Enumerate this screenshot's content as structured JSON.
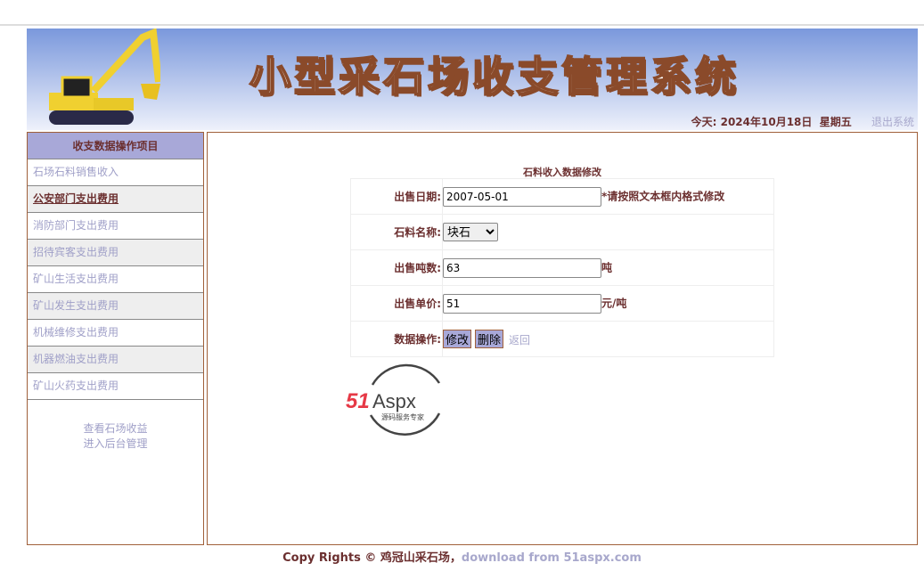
{
  "header": {
    "title": "小型采石场收支管理系统",
    "today_label": "今天:",
    "date": "2024年10月18日",
    "weekday": "星期五",
    "logout": "退出系统"
  },
  "sidebar": {
    "heading": "收支数据操作项目",
    "items": [
      {
        "label": "石场石料销售收入"
      },
      {
        "label": "公安部门支出费用"
      },
      {
        "label": "消防部门支出费用"
      },
      {
        "label": "招待宾客支出费用"
      },
      {
        "label": "矿山生活支出费用"
      },
      {
        "label": "矿山发生支出费用"
      },
      {
        "label": "机械维修支出费用"
      },
      {
        "label": "机器燃油支出费用"
      },
      {
        "label": "矿山火药支出费用"
      }
    ],
    "links": [
      "查看石场收益",
      "进入后台管理"
    ]
  },
  "form": {
    "title": "石料收入数据修改",
    "date_label": "出售日期:",
    "date_value": "2007-05-01",
    "date_hint": "*请按照文本框内格式修改",
    "name_label": "石料名称:",
    "name_value": "块石",
    "tons_label": "出售吨数:",
    "tons_value": "63",
    "tons_unit": "吨",
    "price_label": "出售单价:",
    "price_value": "51",
    "price_unit": "元/吨",
    "ops_label": "数据操作:",
    "modify": "修改",
    "delete": "删除",
    "back": "返回"
  },
  "logo": {
    "text": "51Aspx",
    "subtitle": "源码服务专家"
  },
  "footer": {
    "copyright": "Copy Rights © 鸡冠山采石场，",
    "download": "download from 51aspx.com"
  }
}
